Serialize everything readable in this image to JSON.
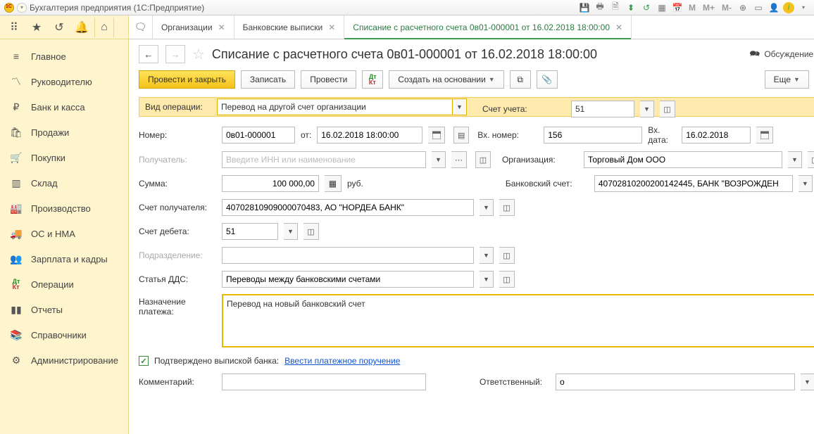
{
  "titlebar": {
    "title": "Бухгалтерия предприятия  (1С:Предприятие)",
    "m": "M",
    "mplus": "M+",
    "mminus": "M-"
  },
  "sidebar": {
    "items": [
      {
        "icon": "≡",
        "label": "Главное"
      },
      {
        "icon": "📈",
        "label": "Руководителю"
      },
      {
        "icon": "₽",
        "label": "Банк и касса"
      },
      {
        "icon": "🛍",
        "label": "Продажи"
      },
      {
        "icon": "🛒",
        "label": "Покупки"
      },
      {
        "icon": "📦",
        "label": "Склад"
      },
      {
        "icon": "🏭",
        "label": "Производство"
      },
      {
        "icon": "🚚",
        "label": "ОС и НМА"
      },
      {
        "icon": "👥",
        "label": "Зарплата и кадры"
      },
      {
        "icon": "Дт",
        "label": "Операции"
      },
      {
        "icon": "📊",
        "label": "Отчеты"
      },
      {
        "icon": "📚",
        "label": "Справочники"
      },
      {
        "icon": "⚙",
        "label": "Администрирование"
      }
    ]
  },
  "tabs": [
    {
      "label": "Организации",
      "active": false
    },
    {
      "label": "Банковские выписки",
      "active": false
    },
    {
      "label": "Списание с расчетного счета 0в01-000001 от 16.02.2018 18:00:00",
      "active": true
    }
  ],
  "header": {
    "title": "Списание с расчетного счета 0в01-000001 от 16.02.2018 18:00:00",
    "discuss": "Обсуждение"
  },
  "toolbar": {
    "post_close": "Провести и закрыть",
    "save": "Записать",
    "post": "Провести",
    "create_based": "Создать на основании",
    "more": "Еще",
    "help": "?"
  },
  "form": {
    "op_label": "Вид операции:",
    "op_value": "Перевод на другой счет организации",
    "account_label": "Счет учета:",
    "account_value": "51",
    "number_label": "Номер:",
    "number_value": "0в01-000001",
    "date_label": "от:",
    "date_value": "16.02.2018 18:00:00",
    "incoming_no_label": "Вх. номер:",
    "incoming_no_value": "156",
    "incoming_date_label": "Вх. дата:",
    "incoming_date_value": "16.02.2018",
    "recipient_label": "Получатель:",
    "recipient_placeholder": "Введите ИНН или наименование",
    "org_label": "Организация:",
    "org_value": "Торговый Дом ООО",
    "sum_label": "Сумма:",
    "sum_value": "100 000,00",
    "sum_cur": "руб.",
    "bank_acc_label": "Банковский счет:",
    "bank_acc_value": "40702810200200142445, БАНК \"ВОЗРОЖДЕН",
    "rec_acc_label": "Счет получателя:",
    "rec_acc_value": "40702810909000070483, АО \"НОРДЕА БАНК\"",
    "debit_label": "Счет дебета:",
    "debit_value": "51",
    "dept_label": "Подразделение:",
    "dds_label": "Статья ДДС:",
    "dds_value": "Переводы между банковскими счетами",
    "purpose_label": "Назначение платежа:",
    "purpose_value": "Перевод на новый банковский счет",
    "confirmed_label": "Подтверждено выпиской банка:",
    "pay_order_link": "Ввести платежное поручение",
    "comment_label": "Комментарий:",
    "responsible_label": "Ответственный:",
    "responsible_value": "о"
  }
}
